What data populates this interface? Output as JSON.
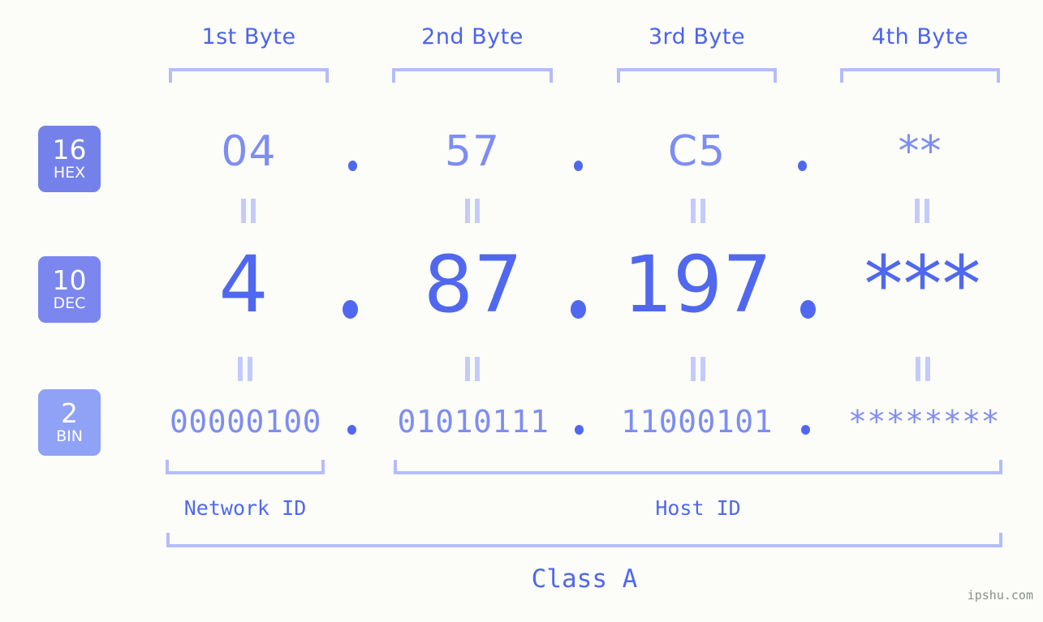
{
  "meta": {
    "background_color": "#fcfdf8",
    "accent_color": "#5068ef",
    "light_accent_color": "#7d8df3",
    "bracket_color": "#b4bdfb",
    "badge_hex_color": "#7581ea",
    "badge_dec_color": "#7b86ee",
    "badge_bin_color": "#8fa2f6",
    "watermark_color": "#8a8f8a"
  },
  "byte_headers": [
    {
      "label": "1st Byte"
    },
    {
      "label": "2nd Byte"
    },
    {
      "label": "3rd Byte"
    },
    {
      "label": "4th Byte"
    }
  ],
  "bases": [
    {
      "number": "16",
      "name": "HEX"
    },
    {
      "number": "10",
      "name": "DEC"
    },
    {
      "number": "2",
      "name": "BIN"
    }
  ],
  "rows": {
    "hex": {
      "base_number": "16",
      "base_name": "HEX",
      "octets": [
        "04",
        "57",
        "C5",
        "**"
      ]
    },
    "dec": {
      "base_number": "10",
      "base_name": "DEC",
      "octets": [
        "4",
        "87",
        "197",
        "***"
      ]
    },
    "bin": {
      "base_number": "2",
      "base_name": "BIN",
      "octets": [
        "00000100",
        "01010111",
        "11000101",
        "********"
      ]
    }
  },
  "separators": {
    "symbol": "."
  },
  "equals": {
    "symbol": "="
  },
  "id_labels": {
    "network": "Network ID",
    "host": "Host ID"
  },
  "class_label": "Class A",
  "watermark": "ipshu.com"
}
